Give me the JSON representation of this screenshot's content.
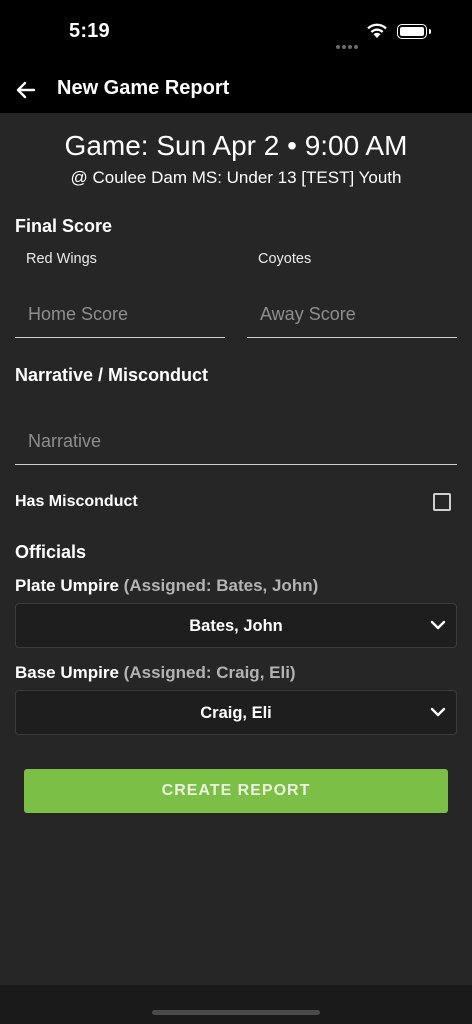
{
  "status_bar": {
    "time": "5:19"
  },
  "header": {
    "title": "New Game Report"
  },
  "game": {
    "title": "Game: Sun Apr 2 • 9:00 AM",
    "subtitle": "@ Coulee Dam MS: Under 13 [TEST] Youth"
  },
  "final_score": {
    "title": "Final Score",
    "home_team": "Red Wings",
    "away_team": "Coyotes",
    "home_placeholder": "Home Score",
    "away_placeholder": "Away Score"
  },
  "narrative": {
    "title": "Narrative / Misconduct",
    "placeholder": "Narrative",
    "misconduct_label": "Has Misconduct",
    "misconduct_checked": false
  },
  "officials": {
    "title": "Officials",
    "plate": {
      "label": "Plate Umpire",
      "assigned": "(Assigned: Bates, John)",
      "value": "Bates, John"
    },
    "base": {
      "label": "Base Umpire",
      "assigned": "(Assigned: Craig, Eli)",
      "value": "Craig, Eli"
    }
  },
  "actions": {
    "create_label": "CREATE REPORT"
  },
  "colors": {
    "accent": "#7cbf46",
    "background": "#262626",
    "header": "#000000"
  }
}
